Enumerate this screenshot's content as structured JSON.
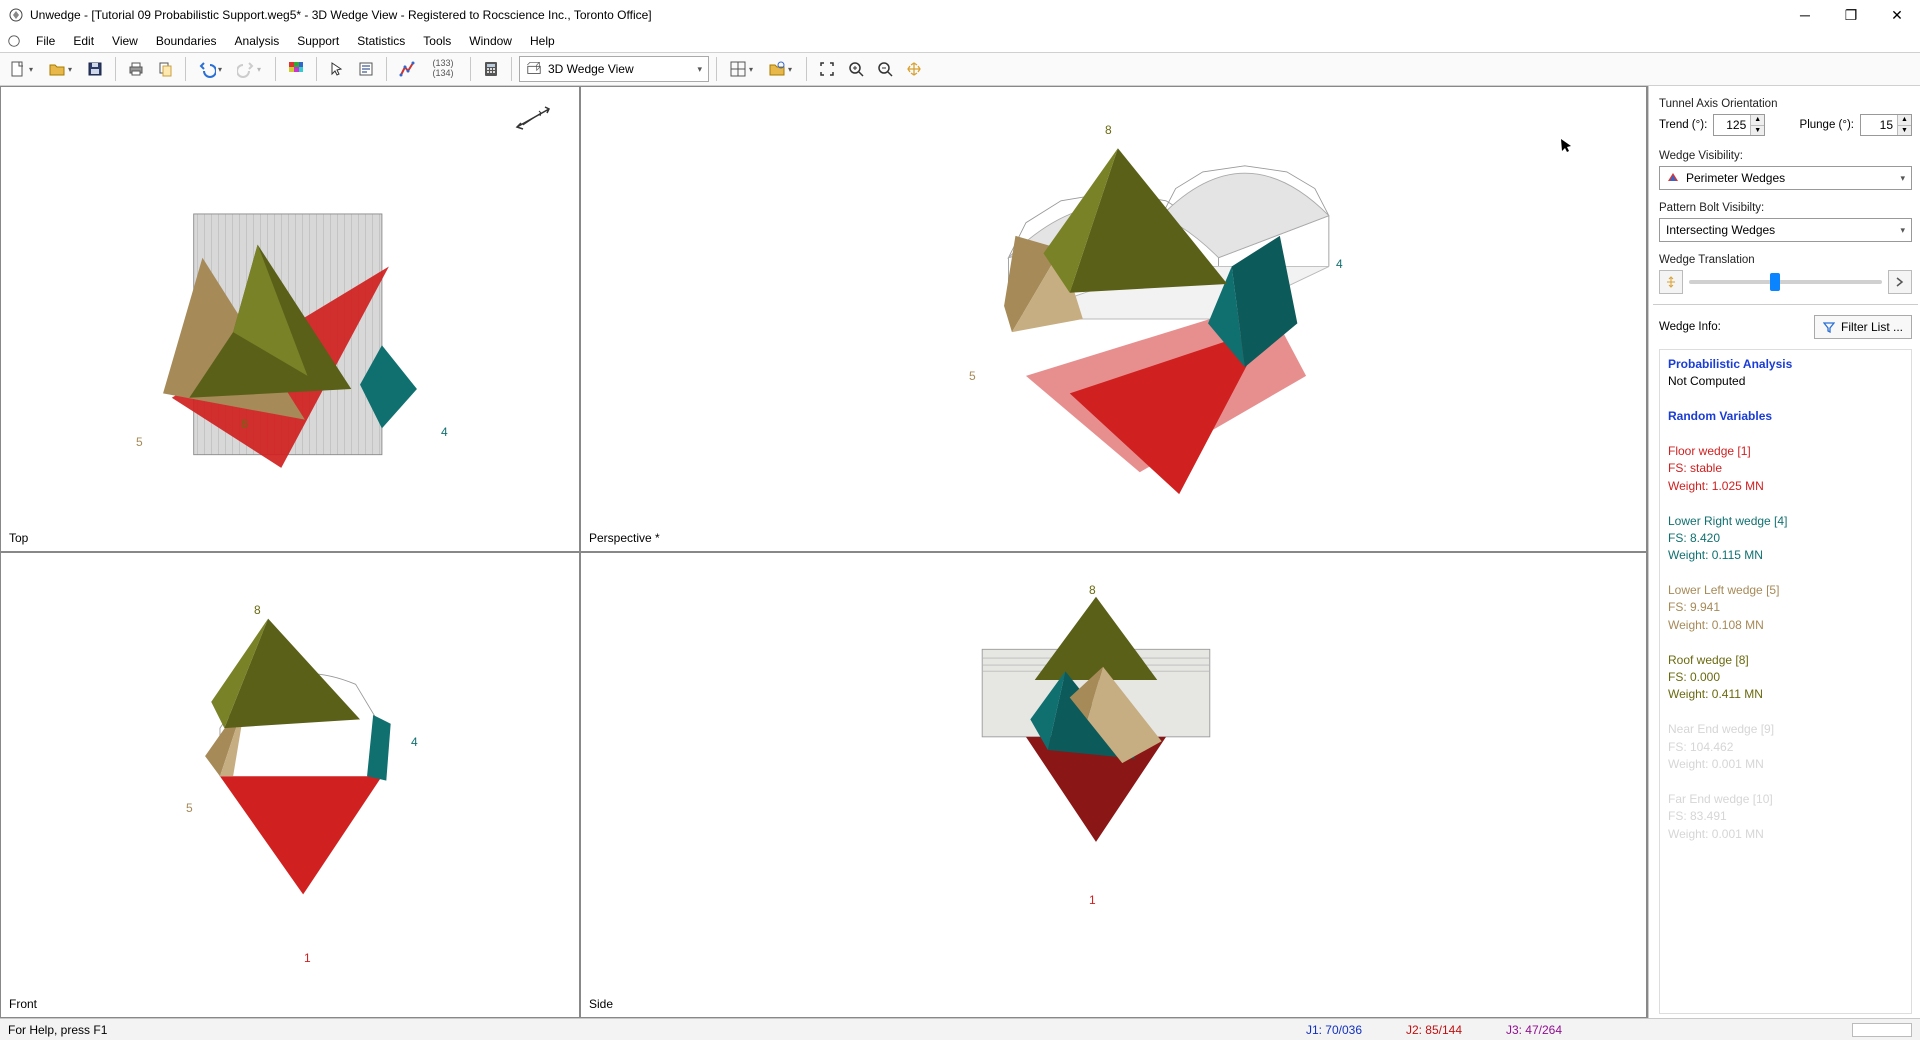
{
  "title": "Unwedge - [Tutorial 09 Probabilistic Support.weg5* - 3D Wedge View - Registered to Rocscience Inc., Toronto Office]",
  "menu": {
    "items": [
      "File",
      "Edit",
      "View",
      "Boundaries",
      "Analysis",
      "Support",
      "Statistics",
      "Tools",
      "Window",
      "Help"
    ]
  },
  "toolbar": {
    "viewsel": "3D Wedge View"
  },
  "views": {
    "tl": "Top",
    "tr": "Perspective *",
    "bl": "Front",
    "br": "Side"
  },
  "side": {
    "orient_title": "Tunnel Axis Orientation",
    "trend_lbl": "Trend (°):",
    "trend_val": "125",
    "plunge_lbl": "Plunge (°):",
    "plunge_val": "15",
    "wv_title": "Wedge Visibility:",
    "wv_val": "Perimeter Wedges",
    "pb_title": "Pattern Bolt Visibilty:",
    "pb_val": "Intersecting Wedges",
    "wt_title": "Wedge Translation",
    "wi_title": "Wedge Info:",
    "filter_btn": "Filter List ..."
  },
  "info": {
    "h1": "Probabilistic Analysis",
    "h1b": "Not Computed",
    "h2": "Random Variables",
    "w1": {
      "t": "Floor wedge [1]",
      "fs": "FS: stable",
      "wt": "Weight: 1.025 MN",
      "c": "#d02020"
    },
    "w4": {
      "t": "Lower Right wedge [4]",
      "fs": "FS: 8.420",
      "wt": "Weight: 0.115 MN",
      "c": "#107070"
    },
    "w5": {
      "t": "Lower Left wedge [5]",
      "fs": "FS: 9.941",
      "wt": "Weight: 0.108 MN",
      "c": "#a68a58"
    },
    "w8": {
      "t": "Roof wedge [8]",
      "fs": "FS: 0.000",
      "wt": "Weight: 0.411 MN",
      "c": "#6a6a10"
    },
    "w9": {
      "t": "Near End wedge [9]",
      "fs": "FS: 104.462",
      "wt": "Weight: 0.001 MN",
      "c": "#d0d0d0"
    },
    "w10": {
      "t": "Far End wedge [10]",
      "fs": "FS: 83.491",
      "wt": "Weight: 0.001 MN",
      "c": "#d0d0d0"
    }
  },
  "status": {
    "help": "For Help, press F1",
    "j1": "J1: 70/036",
    "j2": "J2: 85/144",
    "j3": "J3: 47/264"
  },
  "labels": {
    "n1": "1",
    "n4": "4",
    "n5": "5",
    "n8": "8"
  },
  "colors": {
    "floor": "#d02020",
    "right": "#107070",
    "left": "#a68a58",
    "roof": "#6a6a10",
    "tunnel": "#cfcfcf"
  }
}
